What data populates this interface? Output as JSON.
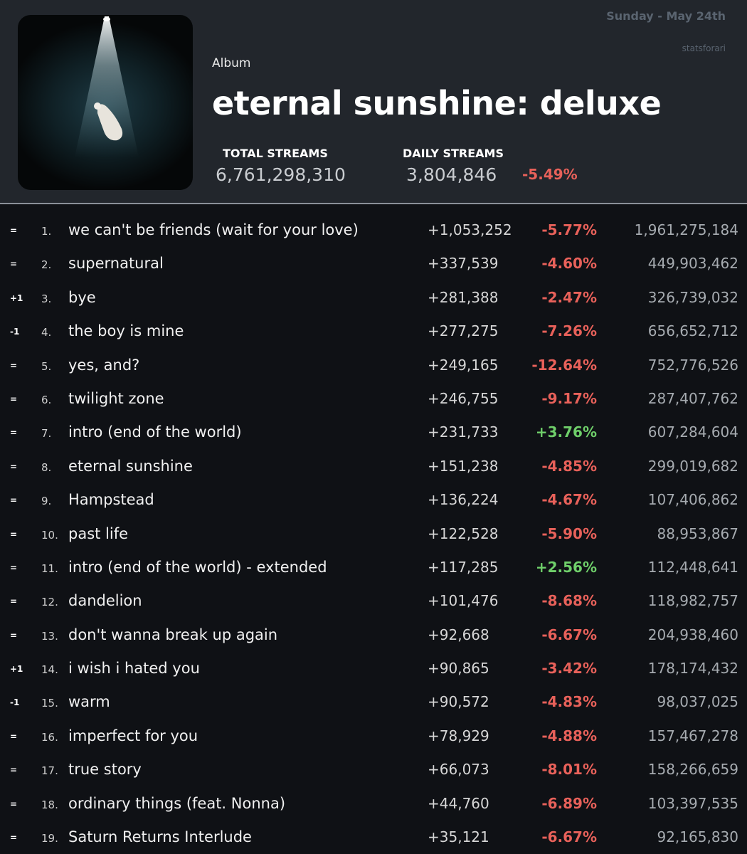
{
  "header": {
    "date": "Sunday - May 24th",
    "credit": "statsforari",
    "type_label": "Album",
    "title": "eternal sunshine: deluxe",
    "total_streams_label": "TOTAL STREAMS",
    "total_streams": "6,761,298,310",
    "daily_streams_label": "DAILY STREAMS",
    "daily_streams": "3,804,846",
    "daily_change": "-5.49%"
  },
  "colors": {
    "background": "#0f1115",
    "header_bg": "#22262c",
    "negative": "#e8615a",
    "positive": "#6fcf6a"
  },
  "tracks": [
    {
      "move": "=",
      "rank": "1.",
      "name": "we can't be friends (wait for your love)",
      "daily": "+1,053,252",
      "change": "-5.77%",
      "total": "1,961,275,184"
    },
    {
      "move": "=",
      "rank": "2.",
      "name": "supernatural",
      "daily": "+337,539",
      "change": "-4.60%",
      "total": "449,903,462"
    },
    {
      "move": "+1",
      "rank": "3.",
      "name": "bye",
      "daily": "+281,388",
      "change": "-2.47%",
      "total": "326,739,032"
    },
    {
      "move": "-1",
      "rank": "4.",
      "name": "the boy is mine",
      "daily": "+277,275",
      "change": "-7.26%",
      "total": "656,652,712"
    },
    {
      "move": "=",
      "rank": "5.",
      "name": "yes, and?",
      "daily": "+249,165",
      "change": "-12.64%",
      "total": "752,776,526"
    },
    {
      "move": "=",
      "rank": "6.",
      "name": "twilight zone",
      "daily": "+246,755",
      "change": "-9.17%",
      "total": "287,407,762"
    },
    {
      "move": "=",
      "rank": "7.",
      "name": "intro (end of the world)",
      "daily": "+231,733",
      "change": "+3.76%",
      "total": "607,284,604"
    },
    {
      "move": "=",
      "rank": "8.",
      "name": "eternal sunshine",
      "daily": "+151,238",
      "change": "-4.85%",
      "total": "299,019,682"
    },
    {
      "move": "=",
      "rank": "9.",
      "name": "Hampstead",
      "daily": "+136,224",
      "change": "-4.67%",
      "total": "107,406,862"
    },
    {
      "move": "=",
      "rank": "10.",
      "name": "past life",
      "daily": "+122,528",
      "change": "-5.90%",
      "total": "88,953,867"
    },
    {
      "move": "=",
      "rank": "11.",
      "name": "intro (end of the world) - extended",
      "daily": "+117,285",
      "change": "+2.56%",
      "total": "112,448,641"
    },
    {
      "move": "=",
      "rank": "12.",
      "name": "dandelion",
      "daily": "+101,476",
      "change": "-8.68%",
      "total": "118,982,757"
    },
    {
      "move": "=",
      "rank": "13.",
      "name": "don't wanna break up again",
      "daily": "+92,668",
      "change": "-6.67%",
      "total": "204,938,460"
    },
    {
      "move": "+1",
      "rank": "14.",
      "name": "i wish i hated you",
      "daily": "+90,865",
      "change": "-3.42%",
      "total": "178,174,432"
    },
    {
      "move": "-1",
      "rank": "15.",
      "name": "warm",
      "daily": "+90,572",
      "change": "-4.83%",
      "total": "98,037,025"
    },
    {
      "move": "=",
      "rank": "16.",
      "name": "imperfect for you",
      "daily": "+78,929",
      "change": "-4.88%",
      "total": "157,467,278"
    },
    {
      "move": "=",
      "rank": "17.",
      "name": "true story",
      "daily": "+66,073",
      "change": "-8.01%",
      "total": "158,266,659"
    },
    {
      "move": "=",
      "rank": "18.",
      "name": "ordinary things (feat. Nonna)",
      "daily": "+44,760",
      "change": "-6.89%",
      "total": "103,397,535"
    },
    {
      "move": "=",
      "rank": "19.",
      "name": "Saturn Returns Interlude",
      "daily": "+35,121",
      "change": "-6.67%",
      "total": "92,165,830"
    }
  ]
}
